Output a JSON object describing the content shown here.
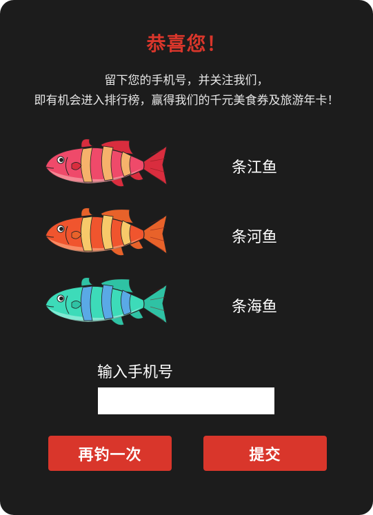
{
  "popup": {
    "title": "恭喜您！",
    "message_line1": "留下您的手机号，并关注我们，",
    "message_line2": "即有机会进入排行榜，赢得我们的千元美食券及旅游年卡！"
  },
  "catches": [
    {
      "label": "条江鱼",
      "icon": "red-fish-icon",
      "colors": {
        "body": "#ef4a6a",
        "stripe": "#f6b26b",
        "fin": "#d92d3e",
        "belly": "#f7a1a7"
      }
    },
    {
      "label": "条河鱼",
      "icon": "orange-fish-icon",
      "colors": {
        "body": "#f0552e",
        "stripe": "#f7c96a",
        "fin": "#e8622a",
        "belly": "#f9a47e"
      }
    },
    {
      "label": "条海鱼",
      "icon": "teal-fish-icon",
      "colors": {
        "body": "#3ddbb9",
        "stripe": "#5aa9e6",
        "fin": "#2fc2a4",
        "belly": "#9ff0de"
      }
    }
  ],
  "phone": {
    "label": "输入手机号",
    "value": "",
    "placeholder": ""
  },
  "buttons": {
    "retry": "再钓一次",
    "submit": "提交"
  },
  "theme": {
    "background": "#1c1c1c",
    "accent": "#d9362b",
    "text": "#ffffff"
  }
}
